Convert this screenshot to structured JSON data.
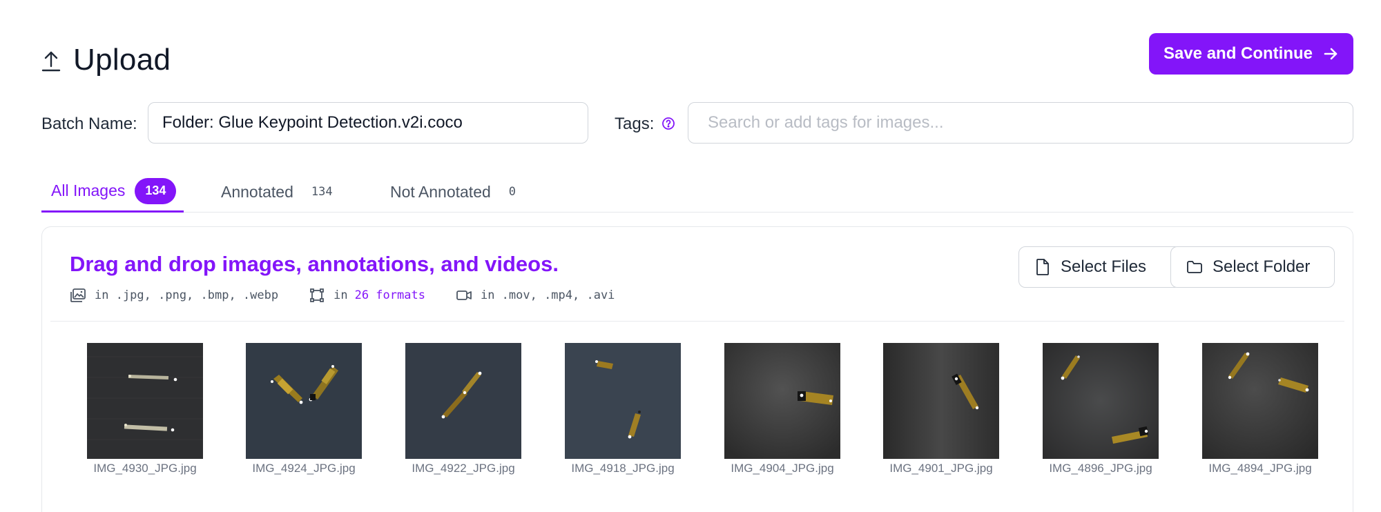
{
  "header": {
    "title": "Upload",
    "save_label": "Save and Continue"
  },
  "form": {
    "batch_label": "Batch Name:",
    "batch_value": "Folder: Glue Keypoint Detection.v2i.coco",
    "tags_label": "Tags:",
    "tags_placeholder": "Search or add tags for images..."
  },
  "tabs": [
    {
      "label": "All Images",
      "count": "134",
      "active": true
    },
    {
      "label": "Annotated",
      "count": "134"
    },
    {
      "label": "Not Annotated",
      "count": "0"
    }
  ],
  "dropzone": {
    "title": "Drag and drop images, annotations, and videos.",
    "images_formats": "in .jpg, .png, .bmp, .webp",
    "annotations_prefix": "in",
    "annotations_formats": "26 formats",
    "video_formats": "in .mov, .mp4, .avi",
    "select_files": "Select Files",
    "select_folder": "Select Folder"
  },
  "colors": {
    "accent": "#8315f9",
    "border": "#d1d5db",
    "text": "#1f2937"
  },
  "images": [
    {
      "name": "IMG_4930_JPG.jpg"
    },
    {
      "name": "IMG_4924_JPG.jpg"
    },
    {
      "name": "IMG_4922_JPG.jpg"
    },
    {
      "name": "IMG_4918_JPG.jpg"
    },
    {
      "name": "IMG_4904_JPG.jpg"
    },
    {
      "name": "IMG_4901_JPG.jpg"
    },
    {
      "name": "IMG_4896_JPG.jpg"
    },
    {
      "name": "IMG_4894_JPG.jpg"
    }
  ]
}
